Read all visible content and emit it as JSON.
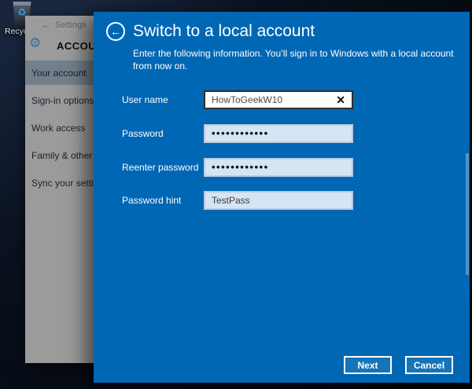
{
  "desktop": {
    "recycle_bin_label": "Recycle Bin"
  },
  "settings_window": {
    "title": "Settings",
    "heading": "ACCOUNTS",
    "sidebar_items": [
      {
        "label": "Your account",
        "selected": true
      },
      {
        "label": "Sign-in options",
        "selected": false
      },
      {
        "label": "Work access",
        "selected": false
      },
      {
        "label": "Family & other users",
        "selected": false
      },
      {
        "label": "Sync your settings",
        "selected": false
      }
    ]
  },
  "dialog": {
    "title": "Switch to a local account",
    "subtitle": "Enter the following information. You’ll sign in to Windows with a local account from now on.",
    "fields": {
      "username": {
        "label": "User name",
        "value": "HowToGeekW10"
      },
      "password": {
        "label": "Password",
        "value": "••••••••••••"
      },
      "reenter": {
        "label": "Reenter password",
        "value": "••••••••••••"
      },
      "hint": {
        "label": "Password hint",
        "value": "TestPass"
      }
    },
    "buttons": {
      "next": "Next",
      "cancel": "Cancel"
    }
  },
  "icons": {
    "back_arrow": "←",
    "gear": "⚙",
    "clear": "✕",
    "recycle": "♻"
  },
  "colors": {
    "accent_blue": "#0067b4",
    "button_blue": "#1674b8",
    "field_blue": "#d6e5f3",
    "selected_item_gray": "#72808c"
  }
}
